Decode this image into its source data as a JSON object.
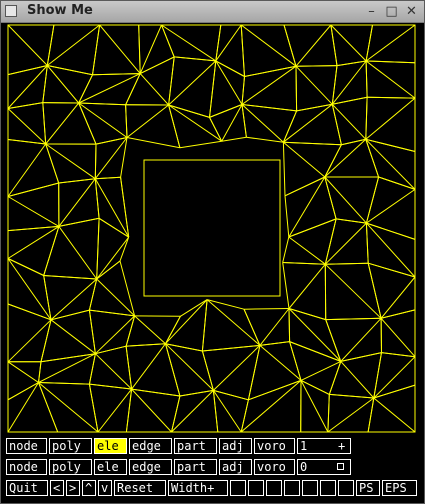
{
  "window": {
    "title": "Show Me"
  },
  "row1": {
    "buttons": [
      "node",
      "poly",
      "ele",
      "edge",
      "part",
      "adj",
      "voro"
    ],
    "active": "ele",
    "value": "1",
    "marker": "+"
  },
  "row2": {
    "buttons": [
      "node",
      "poly",
      "ele",
      "edge",
      "part",
      "adj",
      "voro"
    ],
    "value": "0"
  },
  "row3": {
    "quit": "Quit",
    "left": "<",
    "right": ">",
    "up": "^",
    "down": "v",
    "reset": "Reset",
    "width_plus": "Width+",
    "ps": "PS",
    "eps": "EPS"
  },
  "colors": {
    "mesh": "#ffff00",
    "background": "#000000",
    "active_button": "#ffff00"
  },
  "icons": [
    "window-menu-icon",
    "minimize-icon",
    "maximize-icon",
    "close-icon"
  ]
}
